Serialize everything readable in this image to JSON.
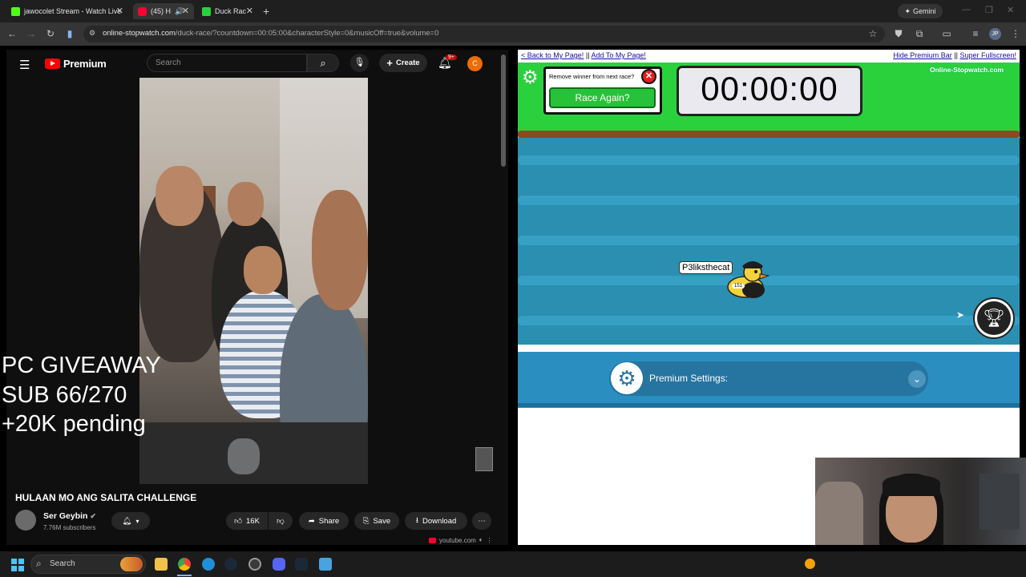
{
  "browser": {
    "tabs": [
      {
        "title": "jawocolet Stream - Watch Live",
        "favicon_color": "#53fc18",
        "active": false
      },
      {
        "title": "(45) H",
        "favicon_color": "#ff0033",
        "active": true
      },
      {
        "title": "Duck Rac",
        "favicon_color": "#2bd13d",
        "active": false
      }
    ],
    "gemini_label": "Gemini",
    "url_host": "online-stopwatch.com",
    "url_path": "/duck-race/?countdown=00:05:00&characterStyle=0&musicOff=true&volume=0",
    "profile_initials": "JP"
  },
  "youtube": {
    "logo_text": "Premium",
    "search_placeholder": "Search",
    "create_label": "Create",
    "notif_badge": "9+",
    "avatar_letter": "C",
    "overlay_lines": [
      "PC GIVEAWAY",
      "SUB 66/270",
      "+20K pending"
    ],
    "video_title": "HULAAN MO ANG SALITA CHALLENGE",
    "channel_name": "Ser Geybin",
    "subscribers": "7.76M subscribers",
    "likes": "16K",
    "share_label": "Share",
    "save_label": "Save",
    "download_label": "Download",
    "footer_domain": "youtube.com"
  },
  "duckrace": {
    "link_back": "< Back to My Page!",
    "link_add": "Add To My Page!",
    "link_hide": "Hide Premium Bar",
    "link_fullscreen": "Super Fullscreen!",
    "separator": "||",
    "remove_winner_label": "Remove winner from next race?",
    "race_again_label": "Race Again?",
    "timer": "00:00:00",
    "brand": "Online-Stopwatch.com",
    "duck_name": "P3liksthecat",
    "duck_number": "151",
    "premium_settings_label": "Premium Settings:"
  },
  "taskbar": {
    "search_label": "Search"
  },
  "colors": {
    "grass": "#2bd13d",
    "water": "#2b8fb2",
    "race_again": "#27c23a",
    "premium_blue": "#2a8ec0"
  }
}
